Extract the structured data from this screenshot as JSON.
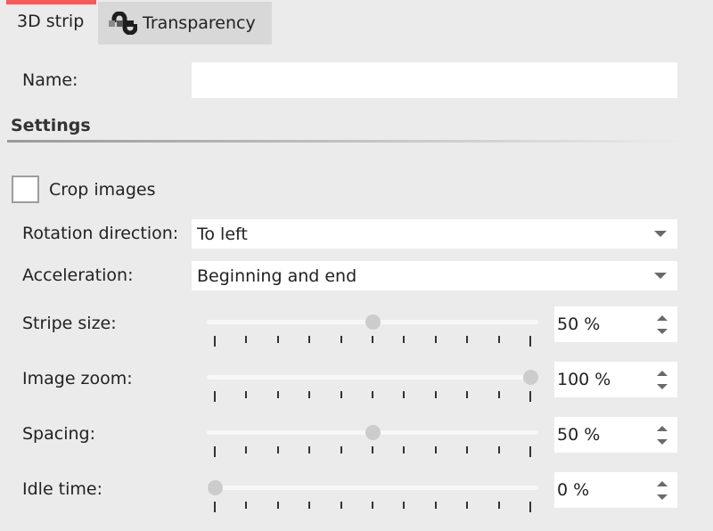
{
  "tabs": [
    {
      "label": "3D strip",
      "active": true,
      "accent_color": "#f45b5b"
    },
    {
      "label": "Transparency",
      "icon": "transparency-icon",
      "active": false
    }
  ],
  "name_field": {
    "label": "Name:",
    "value": "",
    "placeholder": ""
  },
  "settings": {
    "title": "Settings",
    "crop_images": {
      "label": "Crop images",
      "checked": false
    },
    "rotation_direction": {
      "label": "Rotation direction:",
      "value": "To left"
    },
    "acceleration": {
      "label": "Acceleration:",
      "value": "Beginning and end"
    },
    "sliders": [
      {
        "label": "Stripe size:",
        "value": 50,
        "display": "50 %"
      },
      {
        "label": "Image zoom:",
        "value": 100,
        "display": "100 %"
      },
      {
        "label": "Spacing:",
        "value": 50,
        "display": "50 %"
      },
      {
        "label": "Idle time:",
        "value": 0,
        "display": "0 %"
      }
    ]
  }
}
